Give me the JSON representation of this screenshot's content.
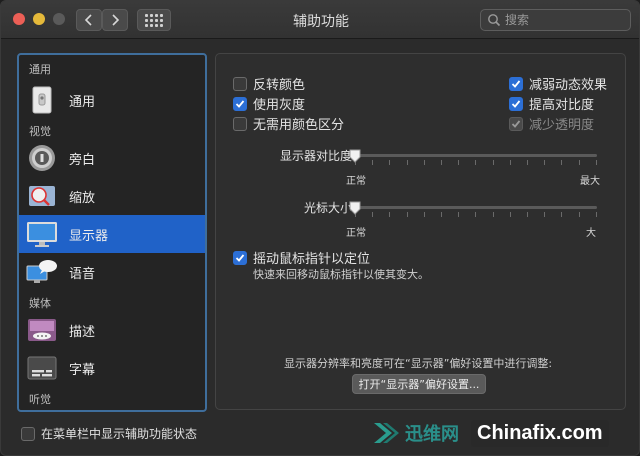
{
  "window": {
    "title": "辅助功能",
    "search_placeholder": "搜索"
  },
  "sidebar": {
    "sections": [
      "通用",
      "视觉",
      "媒体",
      "听觉"
    ],
    "items": [
      {
        "label": "通用",
        "icon": "general-icon"
      },
      {
        "label": "旁白",
        "icon": "voiceover-icon"
      },
      {
        "label": "缩放",
        "icon": "zoom-icon"
      },
      {
        "label": "显示器",
        "icon": "display-icon",
        "selected": true
      },
      {
        "label": "语音",
        "icon": "speech-icon"
      },
      {
        "label": "描述",
        "icon": "descriptions-icon"
      },
      {
        "label": "字幕",
        "icon": "captions-icon"
      }
    ]
  },
  "display": {
    "checkboxes_left": [
      {
        "label": "反转颜色",
        "checked": false
      },
      {
        "label": "使用灰度",
        "checked": true
      },
      {
        "label": "无需用颜色区分",
        "checked": false
      }
    ],
    "checkboxes_right": [
      {
        "label": "减弱动态效果",
        "checked": true
      },
      {
        "label": "提高对比度",
        "checked": true
      },
      {
        "label": "减少透明度",
        "checked": true,
        "disabled": true
      }
    ],
    "contrast": {
      "label": "显示器对比度:",
      "min_label": "正常",
      "max_label": "最大",
      "value": 0
    },
    "cursor": {
      "label": "光标大小:",
      "min_label": "正常",
      "max_label": "大",
      "value": 0
    },
    "shake": {
      "label": "摇动鼠标指针以定位",
      "checked": true,
      "description": "快速来回移动鼠标指针以使其变大。"
    },
    "hint": "显示器分辨率和亮度可在“显示器”偏好设置中进行调整:",
    "open_button": "打开“显示器”偏好设置..."
  },
  "footer": {
    "label": "在菜单栏中显示辅助功能状态",
    "checked": false
  },
  "watermark": {
    "cn": "迅维网",
    "en": "Chinafix.com"
  },
  "colors": {
    "accent": "#2062c8",
    "checkbox_on": "#2c6fd6"
  }
}
